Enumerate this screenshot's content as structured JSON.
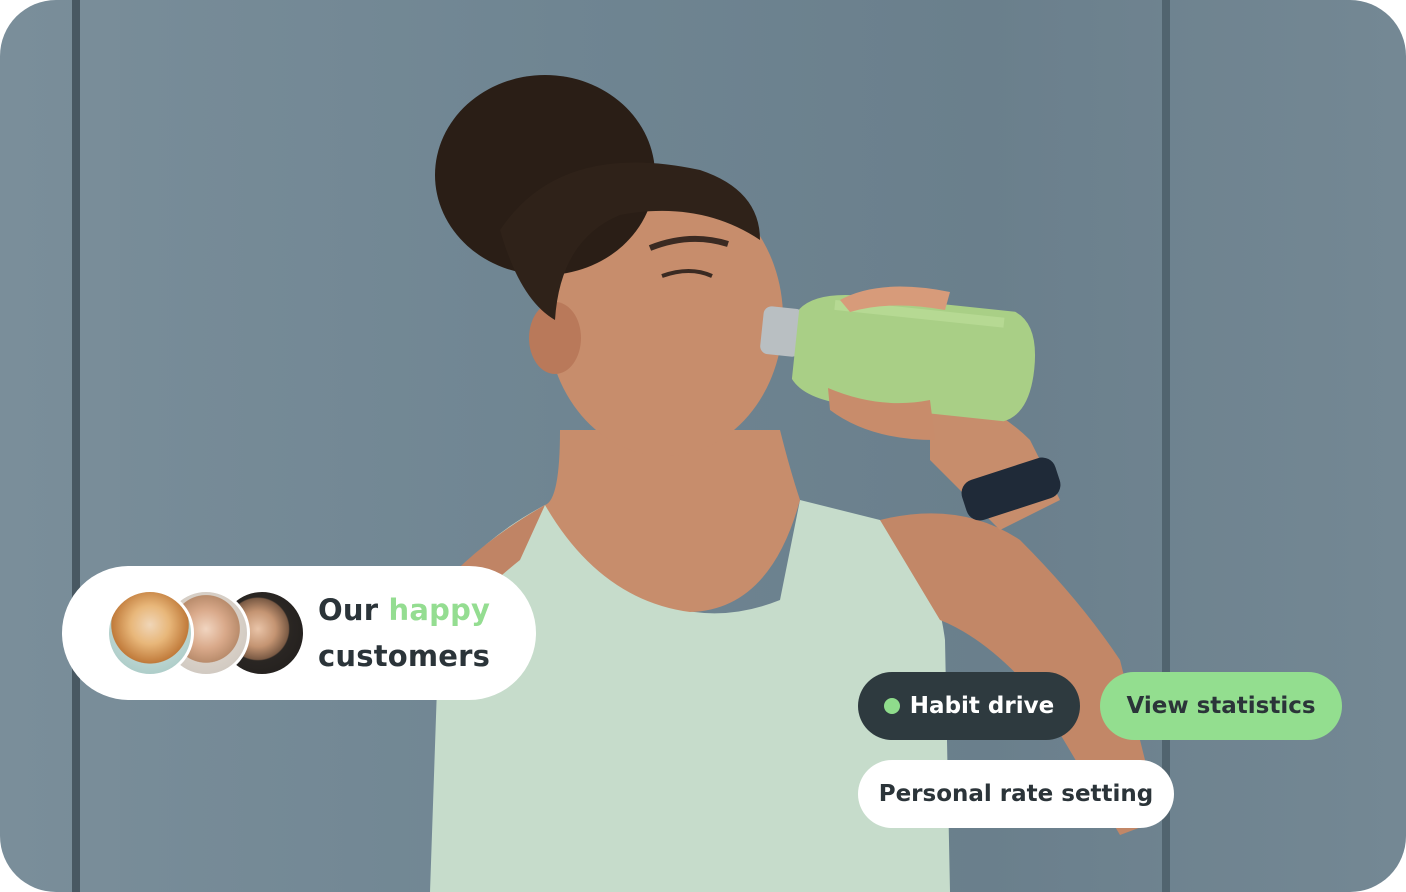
{
  "hero": {
    "image_subject": "woman-drinking-from-green-bottle",
    "colors": {
      "wall": "#6f8592",
      "bottle": "#a9cf86",
      "tank_top": "#c6dccb",
      "skin": "#c78d6c",
      "hair": "#2a1e16",
      "watch": "#1f2a38"
    }
  },
  "customers_card": {
    "prefix": "Our",
    "highlight": "happy",
    "suffix": "customers",
    "highlight_color": "#94dd91",
    "avatars": [
      "blonde-woman-avatar",
      "young-man-avatar",
      "dark-hair-woman-avatar"
    ]
  },
  "pills": {
    "habit": "Habit drive",
    "stats": "View statistics",
    "rate": "Personal rate setting"
  },
  "colors": {
    "text_dark": "#2b3439",
    "pill_dark": "#2e3a3f",
    "accent_green": "#93de8f"
  }
}
